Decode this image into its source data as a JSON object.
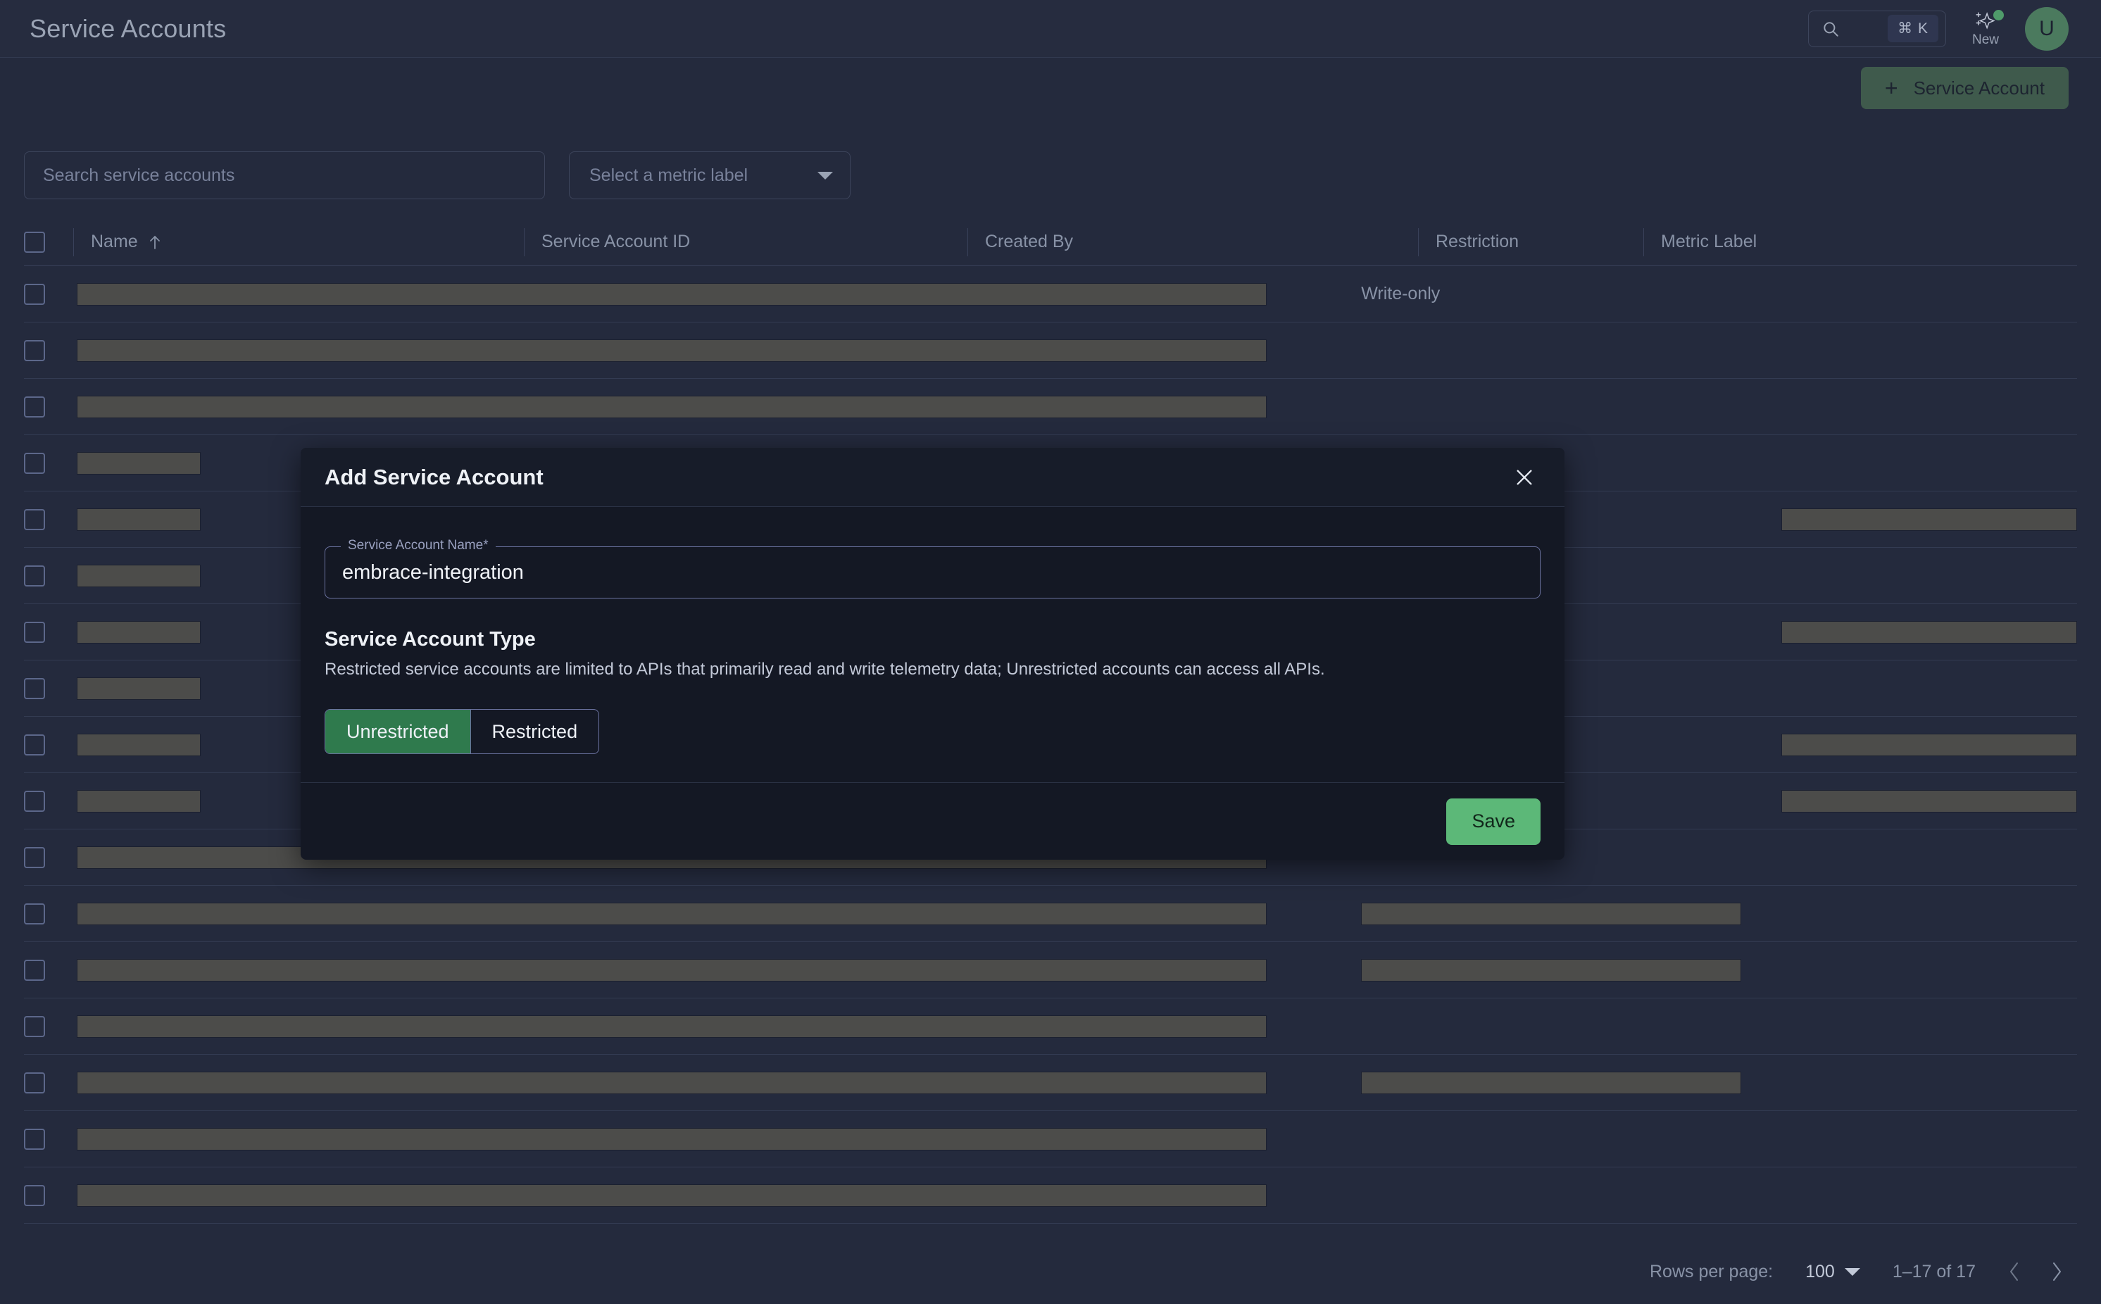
{
  "header": {
    "title": "Service Accounts",
    "search_shortcut": "⌘ K",
    "new_label": "New",
    "avatar_initial": "U",
    "icons": {
      "search": "search-icon",
      "sparkle": "sparkle-new-icon",
      "badge_dot": "notification-dot"
    }
  },
  "actions": {
    "add_service_account": "Service Account",
    "plus": "+"
  },
  "filters": {
    "search_placeholder": "Search service accounts",
    "search_value": "",
    "metric_label_placeholder": "Select a metric label"
  },
  "table": {
    "columns": [
      {
        "key": "name",
        "label": "Name",
        "sorted": "asc"
      },
      {
        "key": "service_account_id",
        "label": "Service Account ID"
      },
      {
        "key": "created_by",
        "label": "Created By"
      },
      {
        "key": "restriction",
        "label": "Restriction"
      },
      {
        "key": "metric_label",
        "label": "Metric Label"
      }
    ],
    "rows": [
      {
        "name": "",
        "wide": true,
        "restriction": "Write-only",
        "restriction_redacted": false,
        "metric_label_redacted": false
      },
      {
        "name": "",
        "wide": true,
        "restriction": "",
        "restriction_redacted": false,
        "metric_label_redacted": false
      },
      {
        "name": "",
        "wide": true,
        "restriction": "",
        "restriction_redacted": false,
        "metric_label_redacted": false
      },
      {
        "name": "",
        "wide": false,
        "restriction": "",
        "restriction_redacted": false,
        "metric_label_redacted": false
      },
      {
        "name": "",
        "wide": false,
        "restriction": "",
        "restriction_redacted": false,
        "metric_label_redacted": true
      },
      {
        "name": "",
        "wide": false,
        "restriction": "",
        "restriction_redacted": false,
        "metric_label_redacted": false
      },
      {
        "name": "",
        "wide": false,
        "restriction": "",
        "restriction_redacted": false,
        "metric_label_redacted": true
      },
      {
        "name": "",
        "wide": false,
        "restriction": "",
        "restriction_redacted": false,
        "metric_label_redacted": false
      },
      {
        "name": "",
        "wide": false,
        "restriction": "",
        "restriction_redacted": false,
        "metric_label_redacted": true
      },
      {
        "name": "",
        "wide": false,
        "restriction": "",
        "restriction_redacted": false,
        "metric_label_redacted": true
      },
      {
        "name": "",
        "wide": true,
        "restriction": "",
        "restriction_redacted": false,
        "metric_label_redacted": false
      },
      {
        "name": "",
        "wide": true,
        "restriction": "",
        "restriction_redacted": true,
        "metric_label_redacted": false
      },
      {
        "name": "",
        "wide": true,
        "restriction": "",
        "restriction_redacted": true,
        "metric_label_redacted": false
      },
      {
        "name": "",
        "wide": true,
        "restriction": "",
        "restriction_redacted": false,
        "metric_label_redacted": false
      },
      {
        "name": "",
        "wide": true,
        "restriction": "",
        "restriction_redacted": true,
        "metric_label_redacted": false
      },
      {
        "name": "",
        "wide": true,
        "restriction": "",
        "restriction_redacted": false,
        "metric_label_redacted": false
      },
      {
        "name": "",
        "wide": true,
        "restriction": "",
        "restriction_redacted": false,
        "metric_label_redacted": false
      }
    ]
  },
  "pagination": {
    "rows_per_page_label": "Rows per page:",
    "rows_per_page_value": "100",
    "range_label": "1–17 of 17",
    "prev": "‹",
    "next": "›"
  },
  "modal": {
    "title": "Add Service Account",
    "close_label": "×",
    "name_field": {
      "legend": "Service Account Name*",
      "value": "embrace-integration",
      "placeholder": ""
    },
    "type_section": {
      "title": "Service Account Type",
      "description": "Restricted service accounts are limited to APIs that primarily read and write telemetry data; Unrestricted accounts can access all APIs.",
      "options": [
        {
          "label": "Unrestricted",
          "selected": true
        },
        {
          "label": "Restricted",
          "selected": false
        }
      ]
    },
    "save_label": "Save"
  },
  "colors": {
    "page_bg": "#242a3d",
    "topbar_bg": "#262c3f",
    "modal_bg": "#141824",
    "accent_green": "#5cb878",
    "segment_green": "#2f7a4d",
    "primary_btn_green": "#3f5a4c",
    "avatar_green": "#4b7a5e",
    "redaction": "#4c4c4a",
    "muted_text": "#8892a6"
  }
}
